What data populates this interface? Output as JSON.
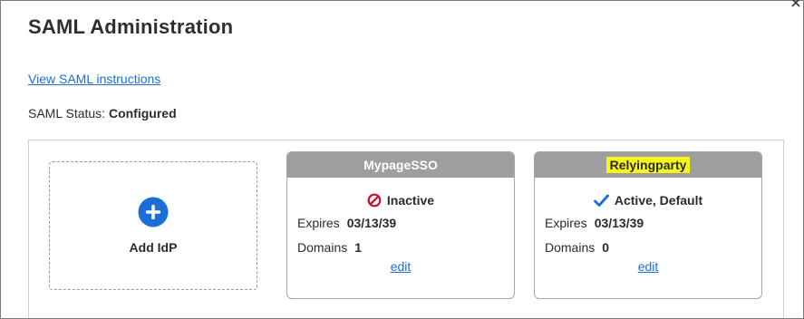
{
  "dialog": {
    "title": "SAML Administration",
    "instructions_link": "View SAML instructions",
    "status_label": "SAML Status:",
    "status_value": "Configured"
  },
  "add_idp": {
    "label": "Add IdP",
    "icon": "plus-circle-icon",
    "icon_color": "#1a6ed6"
  },
  "idps": [
    {
      "name": "MypageSSO",
      "status_icon": "prohibited-icon",
      "status_color": "#c8102e",
      "status": "Inactive",
      "expires_label": "Expires",
      "expires": "03/13/39",
      "domains_label": "Domains",
      "domains": "1",
      "edit": "edit"
    },
    {
      "name": "Relyingparty",
      "highlighted": true,
      "status_icon": "check-icon",
      "status_color": "#1a6ed6",
      "status": "Active, Default",
      "expires_label": "Expires",
      "expires": "03/13/39",
      "domains_label": "Domains",
      "domains": "0",
      "edit": "edit"
    }
  ]
}
